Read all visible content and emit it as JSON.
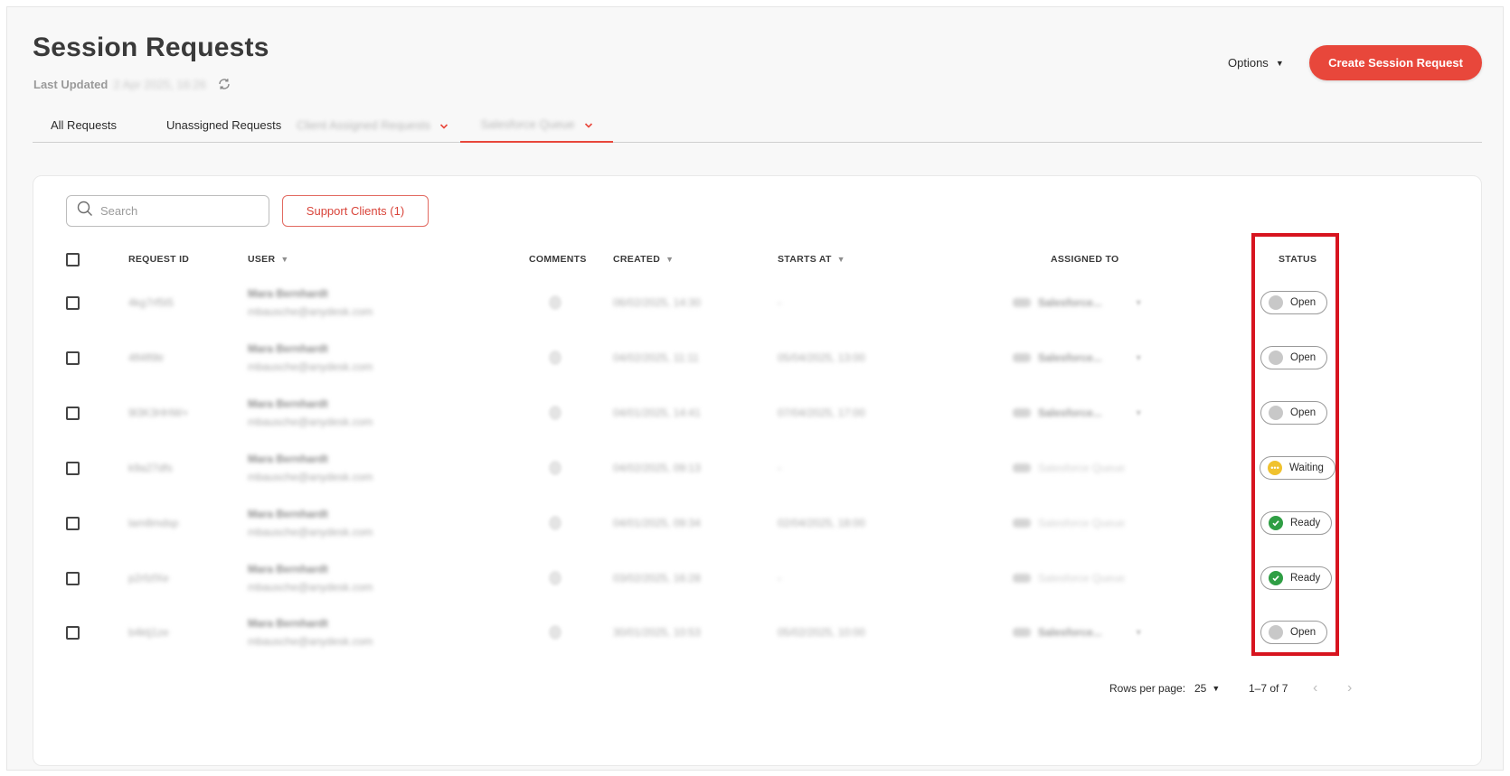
{
  "header": {
    "title": "Session Requests",
    "last_updated_label": "Last Updated",
    "last_updated_value": "2 Apr 2025, 16:26",
    "options_label": "Options",
    "create_button": "Create Session Request"
  },
  "tabs": [
    {
      "label": "All Requests"
    },
    {
      "label": "Unassigned Requests"
    },
    {
      "label": "Client Assigned Requests"
    },
    {
      "label": "Salesforce Queue"
    }
  ],
  "toolbar": {
    "search_placeholder": "Search",
    "support_clients_button": "Support Clients (1)"
  },
  "table": {
    "columns": {
      "request_id": "REQUEST ID",
      "user": "USER",
      "comments": "COMMENTS",
      "created": "CREATED",
      "starts_at": "STARTS AT",
      "assigned_to": "ASSIGNED TO",
      "status": "STATUS"
    },
    "rows": [
      {
        "id": "4kg7rf5t5",
        "name": "Mara Bernhardt",
        "email": "mbausche@anydesk.com",
        "created": "06/02/2025, 14:30",
        "starts": "-",
        "assigned": "Salesforce...",
        "status": "Open"
      },
      {
        "id": "4fl4fl9tr",
        "name": "Mara Bernhardt",
        "email": "mbausche@anydesk.com",
        "created": "04/02/2025, 11:11",
        "starts": "05/04/2025, 13:00",
        "assigned": "Salesforce...",
        "status": "Open"
      },
      {
        "id": "9l3K3HHW+",
        "name": "Mara Bernhardt",
        "email": "mbausche@anydesk.com",
        "created": "04/01/2025, 14:41",
        "starts": "07/04/2025, 17:00",
        "assigned": "Salesforce...",
        "status": "Open"
      },
      {
        "id": "k9a27dfs",
        "name": "Mara Bernhardt",
        "email": "mbausche@anydesk.com",
        "created": "04/02/2025, 09:13",
        "starts": "-",
        "assigned": "Salesforce Queue",
        "status": "Waiting"
      },
      {
        "id": "lam8mdsp",
        "name": "Mara Bernhardt",
        "email": "mbausche@anydesk.com",
        "created": "04/01/2025, 09:34",
        "starts": "02/04/2025, 18:00",
        "assigned": "Salesforce Queue",
        "status": "Ready"
      },
      {
        "id": "p2rfzfXe",
        "name": "Mara Bernhardt",
        "email": "mbausche@anydesk.com",
        "created": "03/02/2025, 16:28",
        "starts": "-",
        "assigned": "Salesforce Queue",
        "status": "Ready"
      },
      {
        "id": "b4ktj1ze",
        "name": "Mara Bernhardt",
        "email": "mbausche@anydesk.com",
        "created": "30/01/2025, 10:53",
        "starts": "05/02/2025, 10:00",
        "assigned": "Salesforce...",
        "status": "Open"
      }
    ]
  },
  "pagination": {
    "rows_per_page_label": "Rows per page:",
    "rows_per_page_value": "25",
    "range": "1–7 of 7"
  },
  "colors": {
    "accent": "#e8473b",
    "highlight": "#d7141f",
    "status_open": "#c8c8c8",
    "status_waiting": "#f0c22e",
    "status_ready": "#2f9e44"
  }
}
